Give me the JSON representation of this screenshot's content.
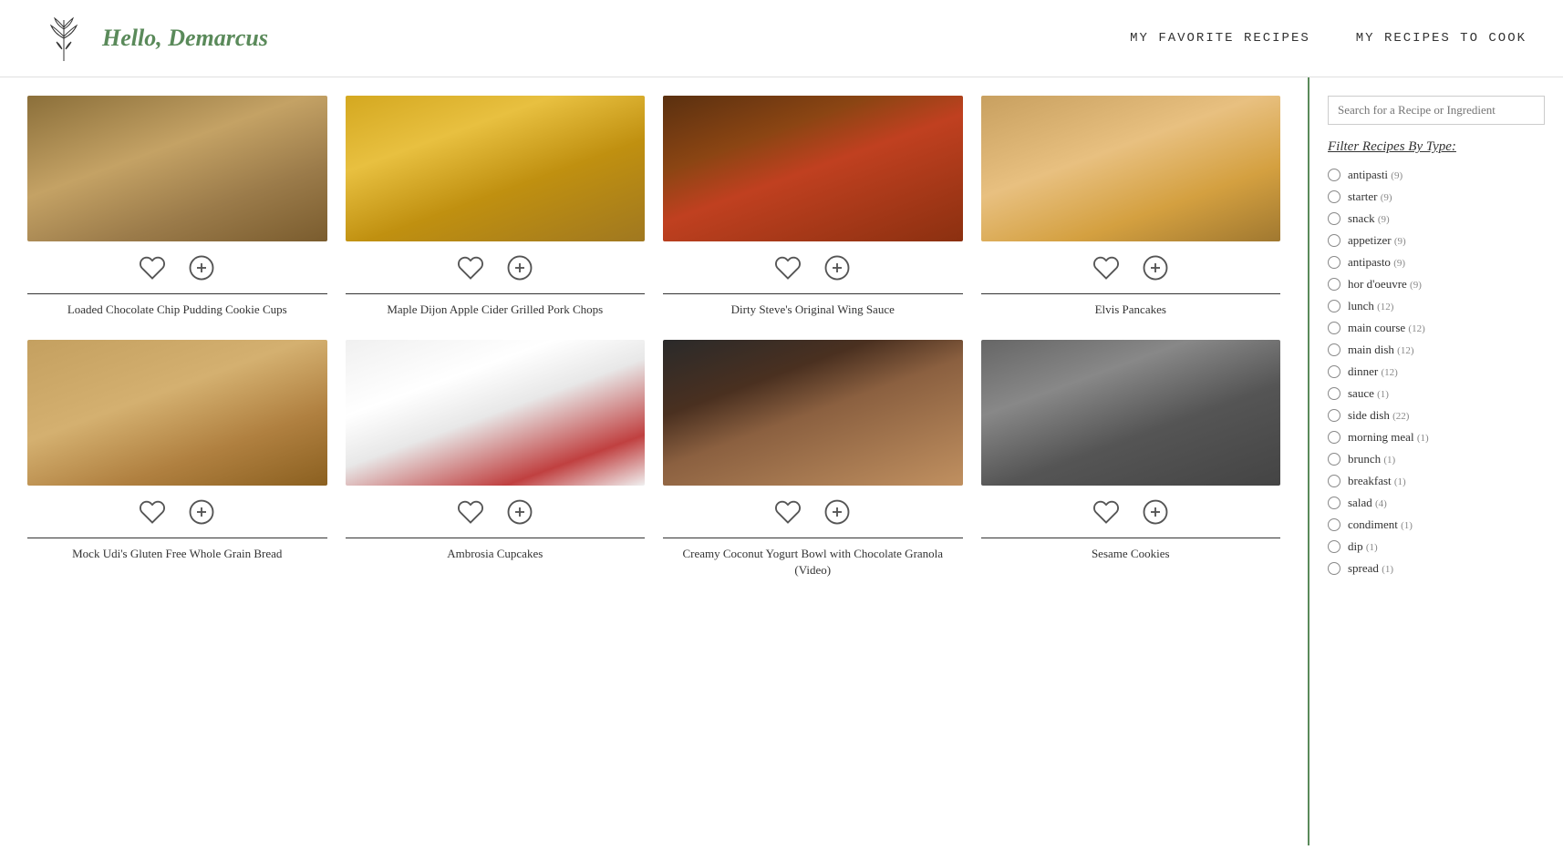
{
  "header": {
    "greeting": "Hello, Demarcus",
    "nav": [
      {
        "label": "MY FAVORITE RECIPES",
        "id": "nav-favorites"
      },
      {
        "label": "MY RECIPES TO COOK",
        "id": "nav-to-cook"
      }
    ]
  },
  "sidebar": {
    "search_placeholder": "Search for a Recipe or Ingredient",
    "filter_heading": "Filter Recipes By Type:",
    "filters": [
      {
        "id": "antipasti",
        "label": "antipasti",
        "count": "(9)"
      },
      {
        "id": "starter",
        "label": "starter",
        "count": "(9)"
      },
      {
        "id": "snack",
        "label": "snack",
        "count": "(9)"
      },
      {
        "id": "appetizer",
        "label": "appetizer",
        "count": "(9)"
      },
      {
        "id": "antipasto",
        "label": "antipasto",
        "count": "(9)"
      },
      {
        "id": "hor-doeuvre",
        "label": "hor d'oeuvre",
        "count": "(9)"
      },
      {
        "id": "lunch",
        "label": "lunch",
        "count": "(12)"
      },
      {
        "id": "main-course",
        "label": "main course",
        "count": "(12)"
      },
      {
        "id": "main-dish",
        "label": "main dish",
        "count": "(12)"
      },
      {
        "id": "dinner",
        "label": "dinner",
        "count": "(12)"
      },
      {
        "id": "sauce",
        "label": "sauce",
        "count": "(1)"
      },
      {
        "id": "side-dish",
        "label": "side dish",
        "count": "(22)"
      },
      {
        "id": "morning-meal",
        "label": "morning meal",
        "count": "(1)"
      },
      {
        "id": "brunch",
        "label": "brunch",
        "count": "(1)"
      },
      {
        "id": "breakfast",
        "label": "breakfast",
        "count": "(1)"
      },
      {
        "id": "salad",
        "label": "salad",
        "count": "(4)"
      },
      {
        "id": "condiment",
        "label": "condiment",
        "count": "(1)"
      },
      {
        "id": "dip",
        "label": "dip",
        "count": "(1)"
      },
      {
        "id": "spread",
        "label": "spread",
        "count": "(1)"
      }
    ]
  },
  "recipes": {
    "row1": [
      {
        "id": "recipe-1",
        "title": "Loaded Chocolate Chip Pudding Cookie Cups",
        "img_class": "img-cookies"
      },
      {
        "id": "recipe-2",
        "title": "Maple Dijon Apple Cider Grilled Pork Chops",
        "img_class": "img-pork"
      },
      {
        "id": "recipe-3",
        "title": "Dirty Steve's Original Wing Sauce",
        "img_class": "img-sauce"
      },
      {
        "id": "recipe-4",
        "title": "Elvis Pancakes",
        "img_class": "img-pancakes"
      }
    ],
    "row2": [
      {
        "id": "recipe-5",
        "title": "Mock Udi's Gluten Free Whole Grain Bread",
        "img_class": "img-bread"
      },
      {
        "id": "recipe-6",
        "title": "Ambrosia Cupcakes",
        "img_class": "img-cupcake"
      },
      {
        "id": "recipe-7",
        "title": "Creamy Coconut Yogurt Bowl with Chocolate Granola (Video)",
        "img_class": "img-yogurt"
      },
      {
        "id": "recipe-8",
        "title": "Sesame Cookies",
        "img_class": "img-sesame"
      }
    ]
  }
}
